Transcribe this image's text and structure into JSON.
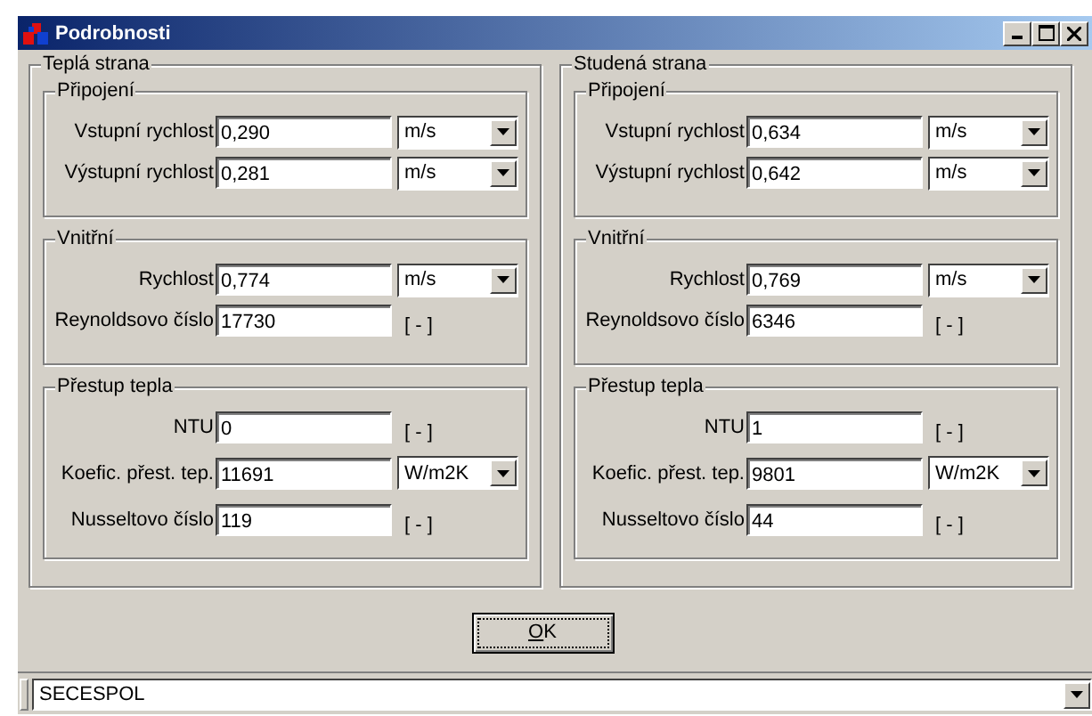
{
  "window": {
    "title": "Podrobnosti"
  },
  "panels": [
    {
      "title": "Teplá strana",
      "groups": [
        {
          "title": "Připojení",
          "rows": [
            {
              "label": "Vstupní rychlost",
              "value": "0,290",
              "kind": "select",
              "unit": "m/s"
            },
            {
              "label": "Výstupní rychlost",
              "value": "0,281",
              "kind": "select",
              "unit": "m/s"
            }
          ]
        },
        {
          "title": "Vnitřní",
          "rows": [
            {
              "label": "Rychlost",
              "value": "0,774",
              "kind": "select",
              "unit": "m/s"
            },
            {
              "label": "Reynoldsovo číslo",
              "value": "17730",
              "kind": "text",
              "unit": "[ - ]"
            }
          ]
        },
        {
          "title": "Přestup tepla",
          "rows": [
            {
              "label": "NTU",
              "value": "0",
              "kind": "text",
              "unit": "[ - ]"
            },
            {
              "label": "Koefic. přest. tep.",
              "value": "11691",
              "kind": "select",
              "unit": "W/m2K"
            },
            {
              "label": "Nusseltovo číslo",
              "value": "119",
              "kind": "text",
              "unit": "[ - ]"
            }
          ]
        }
      ]
    },
    {
      "title": "Studená strana",
      "groups": [
        {
          "title": "Připojení",
          "rows": [
            {
              "label": "Vstupní rychlost",
              "value": "0,634",
              "kind": "select",
              "unit": "m/s"
            },
            {
              "label": "Výstupní rychlost",
              "value": "0,642",
              "kind": "select",
              "unit": "m/s"
            }
          ]
        },
        {
          "title": "Vnitřní",
          "rows": [
            {
              "label": "Rychlost",
              "value": "0,769",
              "kind": "select",
              "unit": "m/s"
            },
            {
              "label": "Reynoldsovo číslo",
              "value": "6346",
              "kind": "text",
              "unit": "[ - ]"
            }
          ]
        },
        {
          "title": "Přestup tepla",
          "rows": [
            {
              "label": "NTU",
              "value": "1",
              "kind": "text",
              "unit": "[ - ]"
            },
            {
              "label": "Koefic. přest. tep.",
              "value": "9801",
              "kind": "select",
              "unit": "W/m2K"
            },
            {
              "label": "Nusseltovo číslo",
              "value": "44",
              "kind": "text",
              "unit": "[ - ]"
            }
          ]
        }
      ]
    }
  ],
  "ok_button": "OK",
  "bottom_combo": {
    "value": "SECESPOL"
  }
}
